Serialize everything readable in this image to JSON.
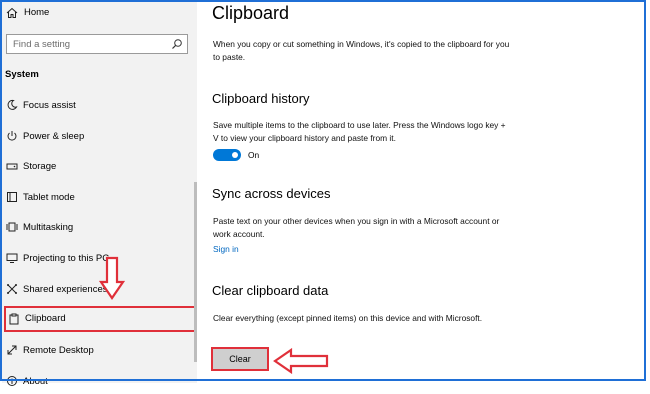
{
  "sidebar": {
    "home_label": "Home",
    "search_placeholder": "Find a setting",
    "section_title": "System",
    "items": [
      {
        "label": "Focus assist",
        "icon": "moon-icon"
      },
      {
        "label": "Power & sleep",
        "icon": "power-icon"
      },
      {
        "label": "Storage",
        "icon": "storage-icon"
      },
      {
        "label": "Tablet mode",
        "icon": "tablet-icon"
      },
      {
        "label": "Multitasking",
        "icon": "multitasking-icon"
      },
      {
        "label": "Projecting to this PC",
        "icon": "projecting-icon"
      },
      {
        "label": "Shared experiences",
        "icon": "shared-icon"
      },
      {
        "label": "Clipboard",
        "icon": "clipboard-icon",
        "active": true
      },
      {
        "label": "Remote Desktop",
        "icon": "remote-desktop-icon"
      },
      {
        "label": "About",
        "icon": "info-icon"
      }
    ]
  },
  "main": {
    "title": "Clipboard",
    "intro": "When you copy or cut something in Windows, it's copied to the clipboard for you to paste.",
    "history": {
      "heading": "Clipboard history",
      "description": "Save multiple items to the clipboard to use later. Press the Windows logo key + V to view your clipboard history and paste from it.",
      "toggle_state": "On"
    },
    "sync": {
      "heading": "Sync across devices",
      "description": "Paste text on your other devices when you sign in with a Microsoft account or work account.",
      "link": "Sign in"
    },
    "clear": {
      "heading": "Clear clipboard data",
      "description": "Clear everything (except pinned items) on this device and with Microsoft.",
      "button": "Clear"
    }
  },
  "colors": {
    "accent": "#0078d7",
    "link": "#0067c0",
    "highlight": "#e0303a",
    "sidebar_bg": "#f2f2f2"
  }
}
